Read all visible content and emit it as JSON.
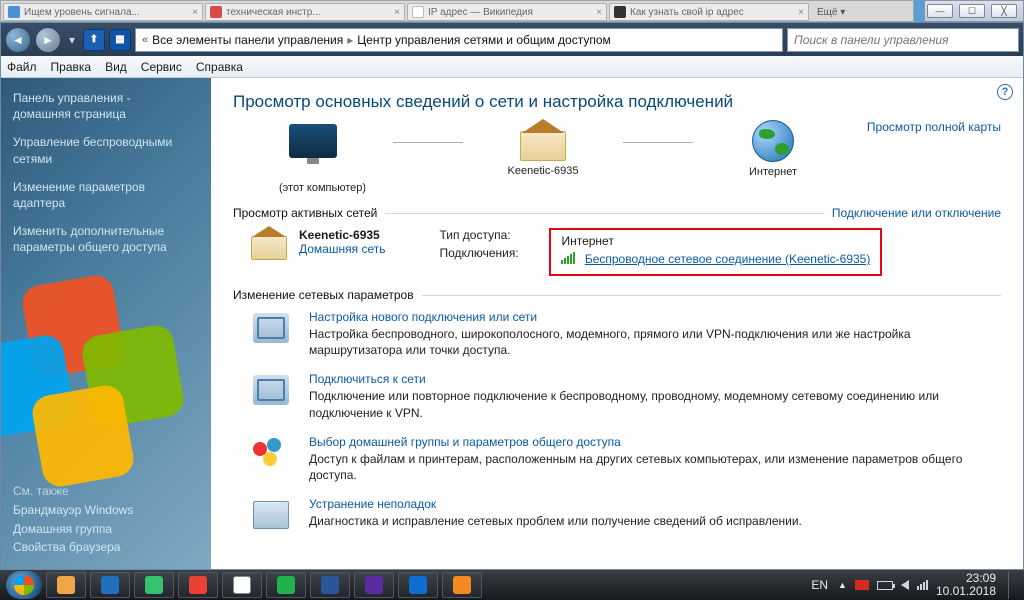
{
  "browser_tabs": [
    {
      "fav": "blue",
      "label": "Ищем уровень сигнала...",
      "close": "×"
    },
    {
      "fav": "red",
      "label": "техническая инстр...",
      "close": "×"
    },
    {
      "fav": "white",
      "label": "IP адрес — Википедия",
      "close": "×"
    },
    {
      "fav": "dark",
      "label": "Как узнать свой ip адрес",
      "close": "×"
    }
  ],
  "browser_extra": "Ещё ▾",
  "winctrls": {
    "min": "—",
    "max": "☐",
    "close": "╳"
  },
  "nav": {
    "back": "◄",
    "fwd": "►",
    "dd": "▾",
    "up_icon": "⬆",
    "grid_icon": "▦",
    "pre": "«",
    "crumb1": "Все элементы панели управления",
    "sep": "▸",
    "crumb2": "Центр управления сетями и общим доступом",
    "search_placeholder": "Поиск в панели управления"
  },
  "menu": {
    "file": "Файл",
    "edit": "Правка",
    "view": "Вид",
    "service": "Сервис",
    "help": "Справка"
  },
  "sidebar": {
    "home1": "Панель управления -",
    "home2": "домашняя страница",
    "l1": "Управление беспроводными сетями",
    "l2": "Изменение параметров адаптера",
    "l3": "Изменить дополнительные параметры общего доступа",
    "see_also": "См. также",
    "s1": "Брандмауэр Windows",
    "s2": "Домашняя группа",
    "s3": "Свойства браузера"
  },
  "content": {
    "help": "?",
    "title": "Просмотр основных сведений о сети и настройка подключений",
    "map_full": "Просмотр полной карты",
    "node_pc": "(этот компьютер)",
    "node_router": "Keenetic-6935",
    "node_net": "Интернет",
    "act_hdr": "Просмотр активных сетей",
    "act_right": "Подключение или отключение",
    "net_name": "Keenetic-6935",
    "net_type": "Домашняя сеть",
    "k_access": "Тип доступа:",
    "v_access": "Интернет",
    "k_conn": "Подключения:",
    "v_conn": "Беспроводное сетевое соединение (Keenetic-6935)",
    "chg_hdr": "Изменение сетевых параметров",
    "items": [
      {
        "t": "Настройка нового подключения или сети",
        "d": "Настройка беспроводного, широкополосного, модемного, прямого или VPN-подключения или же настройка маршрутизатора или точки доступа."
      },
      {
        "t": "Подключиться к сети",
        "d": "Подключение или повторное подключение к беспроводному, проводному, модемному сетевому соединению или подключение к VPN."
      },
      {
        "t": "Выбор домашней группы и параметров общего доступа",
        "d": "Доступ к файлам и принтерам, расположенным на других сетевых компьютерах, или изменение параметров общего доступа."
      },
      {
        "t": "Устранение неполадок",
        "d": "Диагностика и исправление сетевых проблем или получение сведений об исправлении."
      }
    ]
  },
  "taskbar": {
    "apps_colors": [
      "#f0a646",
      "#1f6fbd",
      "#37c26e",
      "#ea4335",
      "#ffffff",
      "#22b14c",
      "#2b579a",
      "#5a2ca0",
      "#0e6fd1",
      "#f38b1e"
    ],
    "lang": "EN",
    "up": "▲",
    "time": "23:09",
    "date": "10.01.2018"
  }
}
